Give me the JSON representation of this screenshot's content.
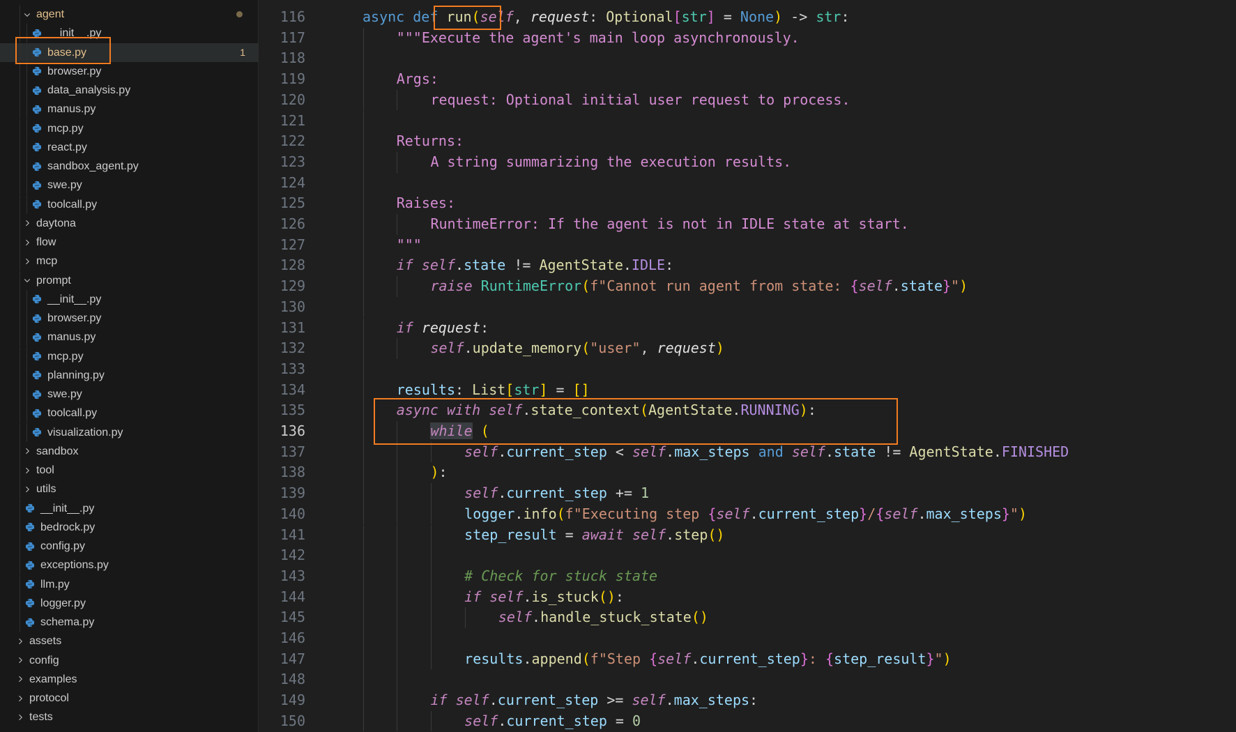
{
  "explorer": {
    "items": [
      {
        "label": "agent",
        "kind": "folder-open",
        "depth": 1,
        "modified": true
      },
      {
        "label": "__init__.py",
        "kind": "py",
        "depth": 2
      },
      {
        "label": "base.py",
        "kind": "py",
        "depth": 2,
        "modified": true,
        "badge": "1",
        "selected": true
      },
      {
        "label": "browser.py",
        "kind": "py",
        "depth": 2
      },
      {
        "label": "data_analysis.py",
        "kind": "py",
        "depth": 2
      },
      {
        "label": "manus.py",
        "kind": "py",
        "depth": 2
      },
      {
        "label": "mcp.py",
        "kind": "py",
        "depth": 2
      },
      {
        "label": "react.py",
        "kind": "py",
        "depth": 2
      },
      {
        "label": "sandbox_agent.py",
        "kind": "py",
        "depth": 2
      },
      {
        "label": "swe.py",
        "kind": "py",
        "depth": 2
      },
      {
        "label": "toolcall.py",
        "kind": "py",
        "depth": 2
      },
      {
        "label": "daytona",
        "kind": "folder",
        "depth": 1
      },
      {
        "label": "flow",
        "kind": "folder",
        "depth": 1
      },
      {
        "label": "mcp",
        "kind": "folder",
        "depth": 1
      },
      {
        "label": "prompt",
        "kind": "folder-open",
        "depth": 1
      },
      {
        "label": "__init__.py",
        "kind": "py",
        "depth": 2
      },
      {
        "label": "browser.py",
        "kind": "py",
        "depth": 2
      },
      {
        "label": "manus.py",
        "kind": "py",
        "depth": 2
      },
      {
        "label": "mcp.py",
        "kind": "py",
        "depth": 2
      },
      {
        "label": "planning.py",
        "kind": "py",
        "depth": 2
      },
      {
        "label": "swe.py",
        "kind": "py",
        "depth": 2
      },
      {
        "label": "toolcall.py",
        "kind": "py",
        "depth": 2
      },
      {
        "label": "visualization.py",
        "kind": "py",
        "depth": 2
      },
      {
        "label": "sandbox",
        "kind": "folder",
        "depth": 1
      },
      {
        "label": "tool",
        "kind": "folder",
        "depth": 1
      },
      {
        "label": "utils",
        "kind": "folder",
        "depth": 1
      },
      {
        "label": "__init__.py",
        "kind": "py",
        "depth": 1
      },
      {
        "label": "bedrock.py",
        "kind": "py",
        "depth": 1
      },
      {
        "label": "config.py",
        "kind": "py",
        "depth": 1
      },
      {
        "label": "exceptions.py",
        "kind": "py",
        "depth": 1
      },
      {
        "label": "llm.py",
        "kind": "py",
        "depth": 1
      },
      {
        "label": "logger.py",
        "kind": "py",
        "depth": 1
      },
      {
        "label": "schema.py",
        "kind": "py",
        "depth": 1
      },
      {
        "label": "assets",
        "kind": "folder",
        "depth": 0
      },
      {
        "label": "config",
        "kind": "folder",
        "depth": 0
      },
      {
        "label": "examples",
        "kind": "folder",
        "depth": 0
      },
      {
        "label": "protocol",
        "kind": "folder",
        "depth": 0
      },
      {
        "label": "tests",
        "kind": "folder",
        "depth": 0
      }
    ]
  },
  "editor": {
    "active_line": "136",
    "lines": [
      {
        "n": "116",
        "indent": 1,
        "toks": [
          [
            "async ",
            "kw"
          ],
          [
            "def ",
            "kw"
          ],
          [
            "run",
            "fn"
          ],
          [
            "(",
            "b1"
          ],
          [
            "self",
            "self"
          ],
          [
            ", ",
            "op"
          ],
          [
            "request",
            "param"
          ],
          [
            ": ",
            "op"
          ],
          [
            "Optional",
            "cls2"
          ],
          [
            "[",
            "b2"
          ],
          [
            "str",
            "cls"
          ],
          [
            "]",
            "b2"
          ],
          [
            " = ",
            "op"
          ],
          [
            "None",
            "kw"
          ],
          [
            ")",
            "b1"
          ],
          [
            " -> ",
            "op"
          ],
          [
            "str",
            "cls"
          ],
          [
            ":",
            "op"
          ]
        ]
      },
      {
        "n": "117",
        "indent": 2,
        "toks": [
          [
            "\"\"\"Execute the agent's main loop asynchronously.",
            "doc"
          ]
        ]
      },
      {
        "n": "118",
        "indent": 2,
        "toks": []
      },
      {
        "n": "119",
        "indent": 2,
        "toks": [
          [
            "Args:",
            "doc"
          ]
        ]
      },
      {
        "n": "120",
        "indent": 3,
        "toks": [
          [
            "request: Optional initial user request to process.",
            "doc"
          ]
        ]
      },
      {
        "n": "121",
        "indent": 2,
        "toks": []
      },
      {
        "n": "122",
        "indent": 2,
        "toks": [
          [
            "Returns:",
            "doc"
          ]
        ]
      },
      {
        "n": "123",
        "indent": 3,
        "toks": [
          [
            "A string summarizing the execution results.",
            "doc"
          ]
        ]
      },
      {
        "n": "124",
        "indent": 2,
        "toks": []
      },
      {
        "n": "125",
        "indent": 2,
        "toks": [
          [
            "Raises:",
            "doc"
          ]
        ]
      },
      {
        "n": "126",
        "indent": 3,
        "toks": [
          [
            "RuntimeError: If the agent is not in IDLE state at start.",
            "doc"
          ]
        ]
      },
      {
        "n": "127",
        "indent": 2,
        "toks": [
          [
            "\"\"\"",
            "doc"
          ]
        ]
      },
      {
        "n": "128",
        "indent": 2,
        "toks": [
          [
            "if ",
            "ctl"
          ],
          [
            "self",
            "self"
          ],
          [
            ".",
            "op"
          ],
          [
            "state",
            "prop"
          ],
          [
            " != ",
            "op"
          ],
          [
            "AgentState",
            "cls2"
          ],
          [
            ".",
            "op"
          ],
          [
            "IDLE",
            "const"
          ],
          [
            ":",
            "op"
          ]
        ]
      },
      {
        "n": "129",
        "indent": 3,
        "toks": [
          [
            "raise ",
            "ctl"
          ],
          [
            "RuntimeError",
            "cls"
          ],
          [
            "(",
            "b1"
          ],
          [
            "f\"Cannot run agent from state: ",
            "str"
          ],
          [
            "{",
            "b2"
          ],
          [
            "self",
            "self"
          ],
          [
            ".",
            "op"
          ],
          [
            "state",
            "prop"
          ],
          [
            "}",
            "b2"
          ],
          [
            "\"",
            "str"
          ],
          [
            ")",
            "b1"
          ]
        ]
      },
      {
        "n": "130",
        "indent": 2,
        "toks": []
      },
      {
        "n": "131",
        "indent": 2,
        "toks": [
          [
            "if ",
            "ctl"
          ],
          [
            "request",
            "param"
          ],
          [
            ":",
            "op"
          ]
        ]
      },
      {
        "n": "132",
        "indent": 3,
        "toks": [
          [
            "self",
            "self"
          ],
          [
            ".",
            "op"
          ],
          [
            "update_memory",
            "fn"
          ],
          [
            "(",
            "b1"
          ],
          [
            "\"user\"",
            "str"
          ],
          [
            ", ",
            "op"
          ],
          [
            "request",
            "param"
          ],
          [
            ")",
            "b1"
          ]
        ]
      },
      {
        "n": "133",
        "indent": 2,
        "toks": []
      },
      {
        "n": "134",
        "indent": 2,
        "toks": [
          [
            "results",
            "prop"
          ],
          [
            ": ",
            "op"
          ],
          [
            "List",
            "cls2"
          ],
          [
            "[",
            "b1"
          ],
          [
            "str",
            "cls"
          ],
          [
            "]",
            "b1"
          ],
          [
            " = ",
            "op"
          ],
          [
            "[]",
            "b1"
          ]
        ]
      },
      {
        "n": "135",
        "indent": 2,
        "toks": [
          [
            "async ",
            "ctl"
          ],
          [
            "with ",
            "ctl"
          ],
          [
            "self",
            "self"
          ],
          [
            ".",
            "op"
          ],
          [
            "state_context",
            "fn"
          ],
          [
            "(",
            "b1"
          ],
          [
            "AgentState",
            "cls2"
          ],
          [
            ".",
            "op"
          ],
          [
            "RUNNING",
            "const"
          ],
          [
            ")",
            "b1"
          ],
          [
            ":",
            "op"
          ]
        ]
      },
      {
        "n": "136",
        "indent": 3,
        "toks": [
          [
            "while",
            "ctl while-hl"
          ],
          [
            " ",
            "op"
          ],
          [
            "(",
            "b1"
          ]
        ]
      },
      {
        "n": "137",
        "indent": 4,
        "toks": [
          [
            "self",
            "self"
          ],
          [
            ".",
            "op"
          ],
          [
            "current_step",
            "prop"
          ],
          [
            " < ",
            "op"
          ],
          [
            "self",
            "self"
          ],
          [
            ".",
            "op"
          ],
          [
            "max_steps",
            "prop"
          ],
          [
            " and ",
            "kw"
          ],
          [
            "self",
            "self"
          ],
          [
            ".",
            "op"
          ],
          [
            "state",
            "prop"
          ],
          [
            " != ",
            "op"
          ],
          [
            "AgentState",
            "cls2"
          ],
          [
            ".",
            "op"
          ],
          [
            "FINISHED",
            "const"
          ]
        ]
      },
      {
        "n": "138",
        "indent": 3,
        "toks": [
          [
            ")",
            "b1"
          ],
          [
            ":",
            "op"
          ]
        ]
      },
      {
        "n": "139",
        "indent": 4,
        "toks": [
          [
            "self",
            "self"
          ],
          [
            ".",
            "op"
          ],
          [
            "current_step",
            "prop"
          ],
          [
            " += ",
            "op"
          ],
          [
            "1",
            "num"
          ]
        ]
      },
      {
        "n": "140",
        "indent": 4,
        "toks": [
          [
            "logger",
            "prop"
          ],
          [
            ".",
            "op"
          ],
          [
            "info",
            "fn"
          ],
          [
            "(",
            "b1"
          ],
          [
            "f\"Executing step ",
            "str"
          ],
          [
            "{",
            "b2"
          ],
          [
            "self",
            "self"
          ],
          [
            ".",
            "op"
          ],
          [
            "current_step",
            "prop"
          ],
          [
            "}",
            "b2"
          ],
          [
            "/",
            "str"
          ],
          [
            "{",
            "b2"
          ],
          [
            "self",
            "self"
          ],
          [
            ".",
            "op"
          ],
          [
            "max_steps",
            "prop"
          ],
          [
            "}",
            "b2"
          ],
          [
            "\"",
            "str"
          ],
          [
            ")",
            "b1"
          ]
        ]
      },
      {
        "n": "141",
        "indent": 4,
        "toks": [
          [
            "step_result",
            "prop"
          ],
          [
            " = ",
            "op"
          ],
          [
            "await ",
            "ctl"
          ],
          [
            "self",
            "self"
          ],
          [
            ".",
            "op"
          ],
          [
            "step",
            "fn"
          ],
          [
            "()",
            "b1"
          ]
        ]
      },
      {
        "n": "142",
        "indent": 4,
        "toks": []
      },
      {
        "n": "143",
        "indent": 4,
        "toks": [
          [
            "# Check for stuck state",
            "cmt"
          ]
        ]
      },
      {
        "n": "144",
        "indent": 4,
        "toks": [
          [
            "if ",
            "ctl"
          ],
          [
            "self",
            "self"
          ],
          [
            ".",
            "op"
          ],
          [
            "is_stuck",
            "fn"
          ],
          [
            "()",
            "b1"
          ],
          [
            ":",
            "op"
          ]
        ]
      },
      {
        "n": "145",
        "indent": 5,
        "toks": [
          [
            "self",
            "self"
          ],
          [
            ".",
            "op"
          ],
          [
            "handle_stuck_state",
            "fn"
          ],
          [
            "()",
            "b1"
          ]
        ]
      },
      {
        "n": "146",
        "indent": 4,
        "toks": []
      },
      {
        "n": "147",
        "indent": 4,
        "toks": [
          [
            "results",
            "prop"
          ],
          [
            ".",
            "op"
          ],
          [
            "append",
            "fn"
          ],
          [
            "(",
            "b1"
          ],
          [
            "f\"Step ",
            "str"
          ],
          [
            "{",
            "b2"
          ],
          [
            "self",
            "self"
          ],
          [
            ".",
            "op"
          ],
          [
            "current_step",
            "prop"
          ],
          [
            "}",
            "b2"
          ],
          [
            ": ",
            "str"
          ],
          [
            "{",
            "b2"
          ],
          [
            "step_result",
            "prop"
          ],
          [
            "}",
            "b2"
          ],
          [
            "\"",
            "str"
          ],
          [
            ")",
            "b1"
          ]
        ]
      },
      {
        "n": "148",
        "indent": 3,
        "toks": []
      },
      {
        "n": "149",
        "indent": 3,
        "toks": [
          [
            "if ",
            "ctl"
          ],
          [
            "self",
            "self"
          ],
          [
            ".",
            "op"
          ],
          [
            "current_step",
            "prop"
          ],
          [
            " >= ",
            "op"
          ],
          [
            "self",
            "self"
          ],
          [
            ".",
            "op"
          ],
          [
            "max_steps",
            "prop"
          ],
          [
            ":",
            "op"
          ]
        ]
      },
      {
        "n": "150",
        "indent": 4,
        "toks": [
          [
            "self",
            "self"
          ],
          [
            ".",
            "op"
          ],
          [
            "current_step",
            "prop"
          ],
          [
            " = ",
            "op"
          ],
          [
            "0",
            "num"
          ]
        ]
      }
    ]
  }
}
